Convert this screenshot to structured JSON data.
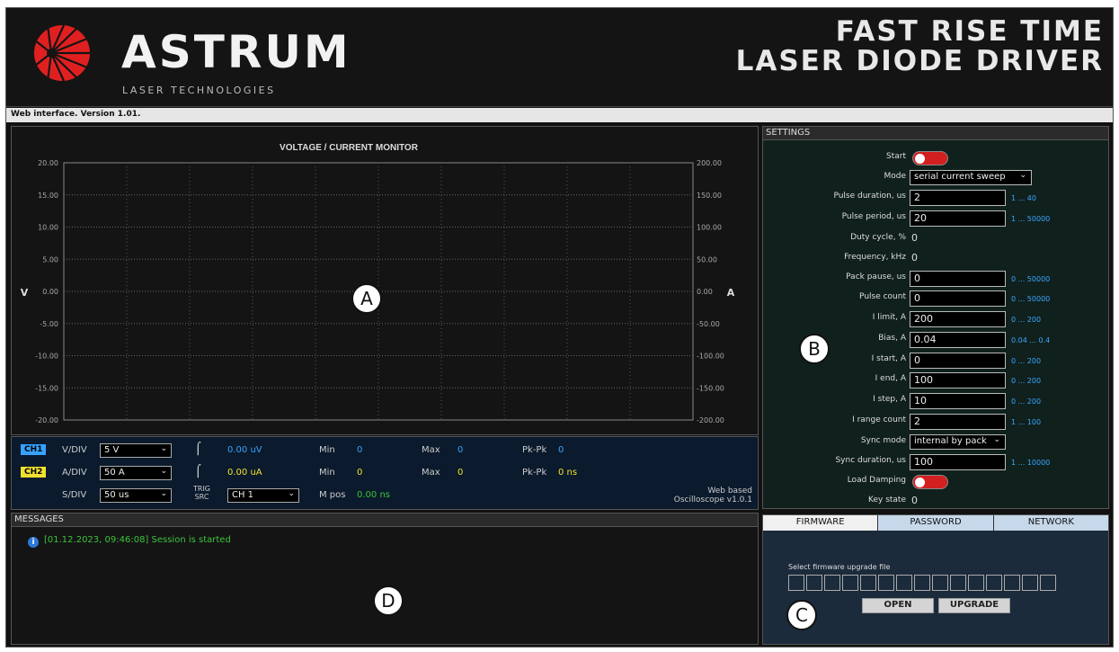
{
  "header": {
    "brand": "ASTRUM",
    "brand_sub": "LASER TECHNOLOGIES",
    "product_line1": "FAST RISE TIME",
    "product_line2": "LASER DIODE DRIVER",
    "logo_color": "#e02020"
  },
  "version": "Web interface. Version 1.01.",
  "chart_data": {
    "type": "line",
    "title": "VOLTAGE / CURRENT MONITOR",
    "y_left_ticks": [
      "20.00",
      "15.00",
      "10.00",
      "5.00",
      "0.00",
      "-5.00",
      "-10.00",
      "-15.00",
      "-20.00"
    ],
    "y_right_ticks": [
      "200.00",
      "150.00",
      "100.00",
      "50.00",
      "0.00",
      "-50.00",
      "-100.00",
      "-150.00",
      "-200.00"
    ],
    "ylim_left": [
      -20,
      20
    ],
    "ylim_right": [
      -200,
      200
    ],
    "ylabel_left": "V",
    "ylabel_right": "A",
    "grid": true,
    "series": []
  },
  "oscilloscope": {
    "ch1": {
      "badge": "CH1",
      "label": "V/DIV",
      "value": "5 V",
      "reading": "0.00 uV",
      "min_label": "Min",
      "min": "0",
      "max_label": "Max",
      "max": "0",
      "pkpk_label": "Pk-Pk",
      "pkpk": "0",
      "color": "#35a3ff"
    },
    "ch2": {
      "badge": "CH2",
      "label": "A/DIV",
      "value": "50 A",
      "reading": "0.00 uA",
      "min_label": "Min",
      "min": "0",
      "max_label": "Max",
      "max": "0",
      "pkpk_label": "Pk-Pk",
      "pkpk": "0 ns",
      "color": "#f0e030"
    },
    "sdiv_label": "S/DIV",
    "sdiv_value": "50 us",
    "trig_line1": "TRIG",
    "trig_line2": "SRC",
    "trig_value": "CH 1",
    "mpos_label": "M pos",
    "mpos_value": "0.00 ns",
    "footer_line1": "Web based",
    "footer_line2": "Oscilloscope v1.0.1"
  },
  "messages": {
    "title": "MESSAGES",
    "items": [
      {
        "icon": "info-icon",
        "text": "[01.12.2023, 09:46:08] Session is started"
      }
    ]
  },
  "settings": {
    "title": "SETTINGS",
    "start_label": "Start",
    "mode_label": "Mode",
    "mode_value": "serial current sweep",
    "pulse_duration_label": "Pulse duration, us",
    "pulse_duration": "2",
    "pulse_duration_range": "1 ... 40",
    "pulse_period_label": "Pulse period, us",
    "pulse_period": "20",
    "pulse_period_range": "1 ... 50000",
    "duty_label": "Duty cycle, %",
    "duty": "0",
    "freq_label": "Frequency, kHz",
    "freq": "0",
    "pack_pause_label": "Pack pause, us",
    "pack_pause": "0",
    "pack_pause_range": "0 ... 50000",
    "pulse_count_label": "Pulse count",
    "pulse_count": "0",
    "pulse_count_range": "0 ... 50000",
    "ilimit_label": "I limit, A",
    "ilimit": "200",
    "ilimit_range": "0 ... 200",
    "bias_label": "Bias, A",
    "bias": "0.04",
    "bias_range": "0.04 ... 0.4",
    "istart_label": "I start, A",
    "istart": "0",
    "istart_range": "0 ... 200",
    "iend_label": "I end, A",
    "iend": "100",
    "iend_range": "0 ... 200",
    "istep_label": "I step, A",
    "istep": "10",
    "istep_range": "0 ... 200",
    "irange_label": "I range count",
    "irange": "2",
    "irange_range": "1 ... 100",
    "sync_mode_label": "Sync mode",
    "sync_mode": "internal by pack",
    "sync_dur_label": "Sync duration, us",
    "sync_dur": "100",
    "sync_dur_range": "1 ... 10000",
    "load_damping_label": "Load Damping",
    "key_state_label": "Key state",
    "key_state": "0"
  },
  "firmware": {
    "tabs": [
      "FIRMWARE",
      "PASSWORD",
      "NETWORK"
    ],
    "select_label": "Select firmware upgrade file",
    "open_label": "OPEN",
    "upgrade_label": "UPGRADE"
  },
  "markers": {
    "a": "A",
    "b": "B",
    "c": "C",
    "d": "D"
  }
}
